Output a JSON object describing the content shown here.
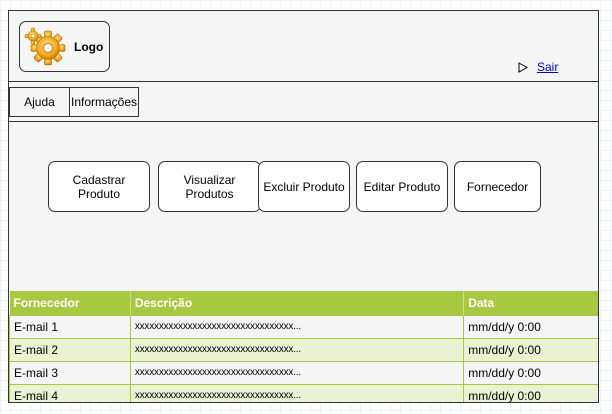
{
  "header": {
    "logo_text": "Logo",
    "logout_label": "Sair"
  },
  "nav": {
    "tabs": [
      {
        "label": "Ajuda"
      },
      {
        "label": "Informações"
      }
    ]
  },
  "actions": {
    "buttons": [
      {
        "label": "Cadastrar\nProduto"
      },
      {
        "label": "Visualizar\nProdutos"
      },
      {
        "label": "Excluir Produto"
      },
      {
        "label": "Editar Produto"
      },
      {
        "label": "Fornecedor"
      }
    ]
  },
  "table": {
    "headers": [
      "Fornecedor",
      "Descrição",
      "Data"
    ],
    "rows": [
      {
        "fornecedor": "E-mail 1",
        "descricao": "xxxxxxxxxxxxxxxxxxxxxxxxxxxxxxxxx...",
        "data": "mm/dd/y 0:00"
      },
      {
        "fornecedor": "E-mail 2",
        "descricao": "xxxxxxxxxxxxxxxxxxxxxxxxxxxxxxxxx...",
        "data": "mm/dd/y 0:00"
      },
      {
        "fornecedor": "E-mail 3",
        "descricao": "xxxxxxxxxxxxxxxxxxxxxxxxxxxxxxxxx...",
        "data": "mm/dd/y 0:00"
      },
      {
        "fornecedor": "E-mail 4",
        "descricao": "xxxxxxxxxxxxxxxxxxxxxxxxxxxxxxxxx...",
        "data": "mm/dd/y 0:00"
      }
    ]
  },
  "colors": {
    "table_header": "#a7c942",
    "row_alt": "#eaf2d3",
    "link": "#0000cc"
  },
  "icons": {
    "logo": "gear-icon",
    "logout": "play-outline-icon"
  }
}
